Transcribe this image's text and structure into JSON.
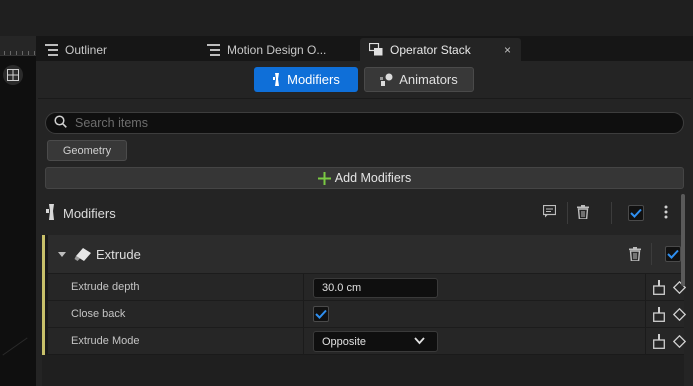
{
  "tabs": [
    {
      "label": "Outliner"
    },
    {
      "label": "Motion Design O..."
    },
    {
      "label": "Operator Stack",
      "close": "×"
    }
  ],
  "toolbar": {
    "modifiers_label": "Modifiers",
    "animators_label": "Animators"
  },
  "search": {
    "placeholder": "Search items",
    "value": ""
  },
  "filter_chip": "Geometry",
  "add_button": "Add Modifiers",
  "section": {
    "title": "Modifiers",
    "enabled": true
  },
  "modifier": {
    "name": "Extrude",
    "enabled": true,
    "properties": [
      {
        "label": "Extrude depth",
        "value": "30.0 cm"
      },
      {
        "label": "Close back",
        "value": true
      },
      {
        "label": "Extrude Mode",
        "value": "Opposite"
      }
    ]
  },
  "colors": {
    "accent": "#0f6fd8",
    "card_stripe": "#c8c06a",
    "add_plus": "#7ac943"
  }
}
